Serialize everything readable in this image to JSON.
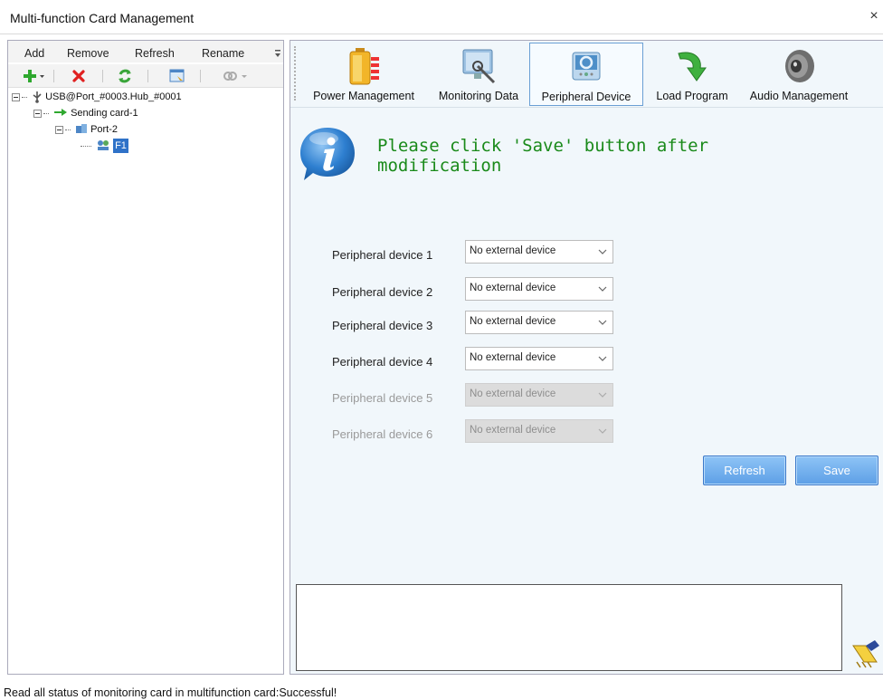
{
  "window": {
    "title": "Multi-function Card Management",
    "close_glyph": "×"
  },
  "left_menu": {
    "items": [
      {
        "label": "Add"
      },
      {
        "label": "Remove"
      },
      {
        "label": "Refresh"
      },
      {
        "label": "Rename"
      }
    ]
  },
  "left_toolbar": {
    "icons": [
      "add-icon",
      "remove-icon",
      "refresh-icon",
      "view-icon",
      "link-icon"
    ]
  },
  "tree": {
    "root": "USB@Port_#0003.Hub_#0001",
    "sending_card": "Sending card-1",
    "port": "Port-2",
    "card": "F1"
  },
  "ribbon": {
    "items": [
      {
        "label": "Power Management",
        "icon": "battery-icon"
      },
      {
        "label": "Monitoring Data",
        "icon": "monitor-icon"
      },
      {
        "label": "Peripheral Device",
        "icon": "device-icon",
        "active": true
      },
      {
        "label": "Load Program",
        "icon": "load-arrow-icon"
      },
      {
        "label": "Audio Management",
        "icon": "speaker-icon"
      }
    ]
  },
  "notice": {
    "text": "Please click 'Save' button after modification"
  },
  "devices": [
    {
      "label": "Peripheral device 1",
      "value": "No external device",
      "enabled": true
    },
    {
      "label": "Peripheral device 2",
      "value": "No external device",
      "enabled": true
    },
    {
      "label": "Peripheral device 3",
      "value": "No external device",
      "enabled": true
    },
    {
      "label": "Peripheral device 4",
      "value": "No external device",
      "enabled": true
    },
    {
      "label": "Peripheral device 5",
      "value": "No external device",
      "enabled": false
    },
    {
      "label": "Peripheral device 6",
      "value": "No external device",
      "enabled": false
    }
  ],
  "buttons": {
    "refresh": "Refresh",
    "save": "Save"
  },
  "status": {
    "text": "Read all status of monitoring card in multifunction card:Successful!"
  }
}
